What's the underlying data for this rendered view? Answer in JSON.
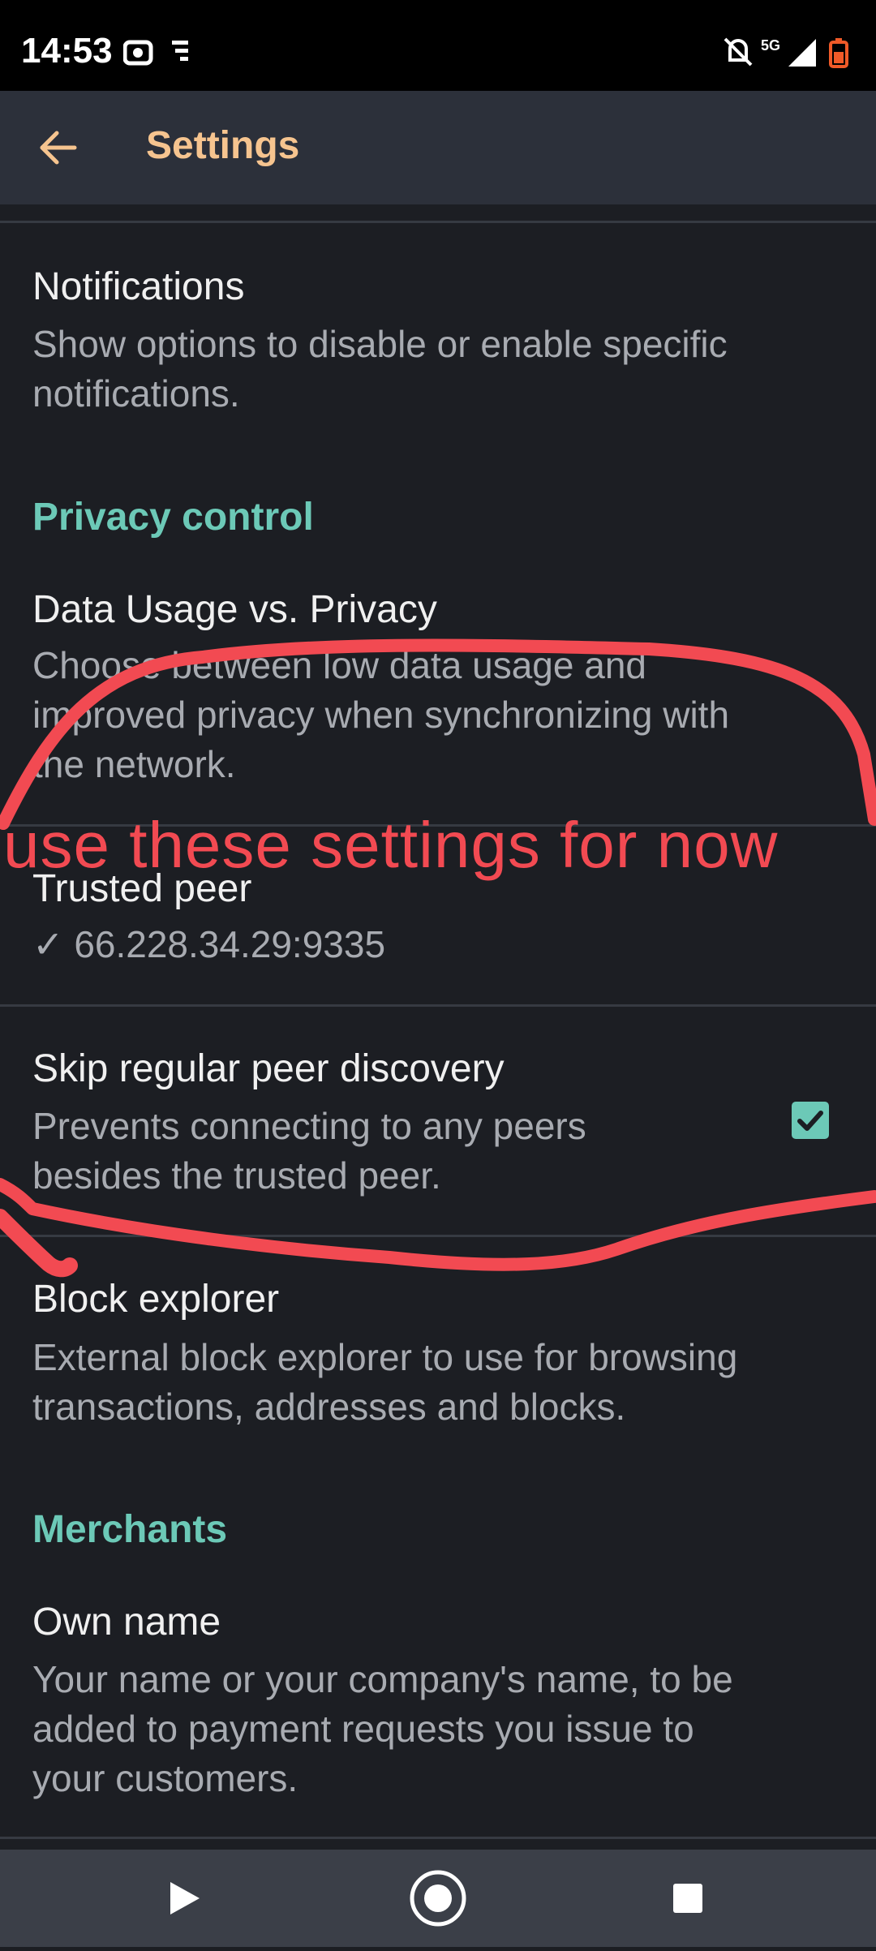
{
  "status_bar": {
    "time": "14:53",
    "network": "5G",
    "icons": [
      "cast-icon",
      "notification-lines-icon",
      "mute-bell-icon",
      "signal-icon",
      "battery-icon"
    ]
  },
  "app_bar": {
    "title": "Settings",
    "back_icon": "arrow-left-icon",
    "accent_color": "#f6c48f"
  },
  "settings": {
    "notifications": {
      "title": "Notifications",
      "summary_line1": "Show options to disable or enable specific",
      "summary_line2": "notifications."
    },
    "privacy_header": "Privacy control",
    "data_usage": {
      "title": "Data Usage vs. Privacy",
      "summary_line1": "Choose between low data usage and",
      "summary_line2": "improved privacy when synchronizing with",
      "summary_line3": "the network."
    },
    "trusted_peer": {
      "title": "Trusted peer",
      "value": "✓ 66.228.34.29:9335"
    },
    "skip_discovery": {
      "title": "Skip regular peer discovery",
      "summary_line1": "Prevents connecting to any peers",
      "summary_line2": "besides the trusted peer.",
      "checked": true
    },
    "block_explorer": {
      "title": "Block explorer",
      "summary_line1": "External block explorer to use for browsing",
      "summary_line2": "transactions, addresses and blocks."
    },
    "merchants_header": "Merchants",
    "own_name": {
      "title": "Own name",
      "summary_line1": "Your name or your company's name, to be",
      "summary_line2": "added to payment requests you issue to",
      "summary_line3": "your customers."
    }
  },
  "annotation": {
    "text": "use these settings for now",
    "color": "#f24a52"
  },
  "nav_bar": {
    "icons": [
      "back-triangle-icon",
      "home-circle-icon",
      "recents-square-icon"
    ]
  }
}
